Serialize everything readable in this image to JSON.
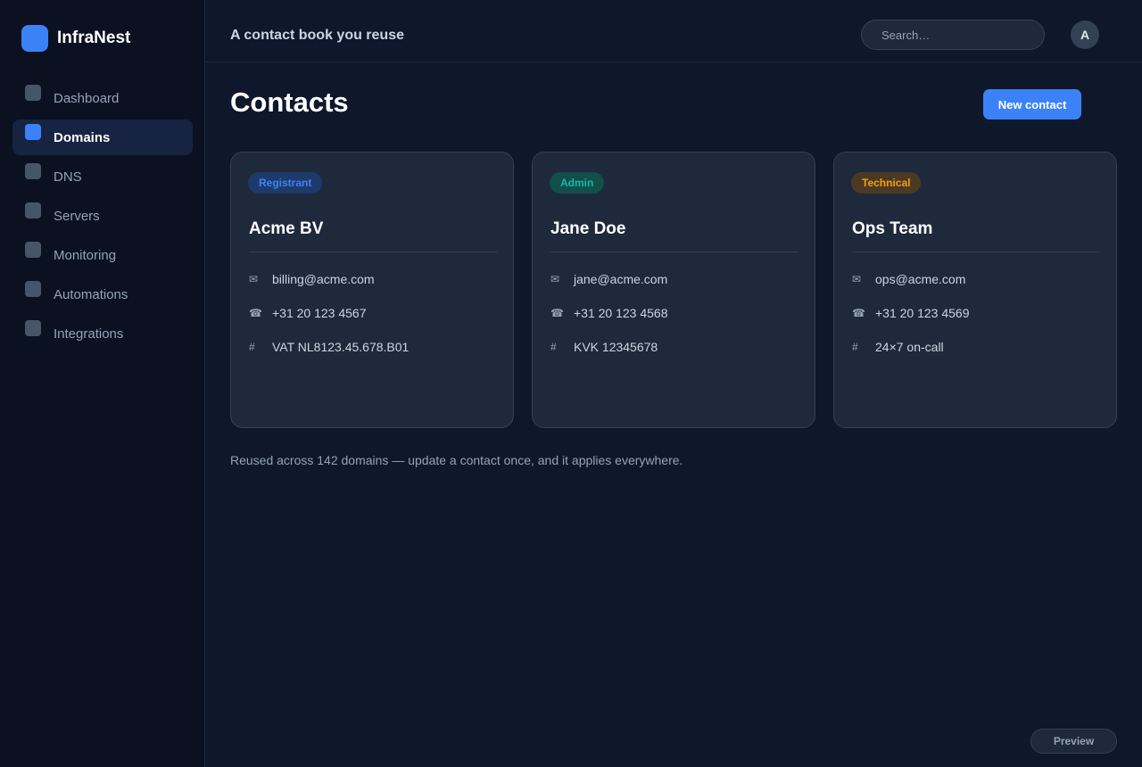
{
  "app": {
    "name": "InfraNest",
    "tagline": "A contact book you reuse"
  },
  "sidebar": {
    "items": [
      {
        "label": "Dashboard",
        "active": false
      },
      {
        "label": "Domains",
        "active": true
      },
      {
        "label": "DNS",
        "active": false
      },
      {
        "label": "Servers",
        "active": false
      },
      {
        "label": "Monitoring",
        "active": false
      },
      {
        "label": "Automations",
        "active": false
      },
      {
        "label": "Integrations",
        "active": false
      }
    ]
  },
  "header": {
    "search_placeholder": "Search…",
    "avatar_initial": "A"
  },
  "main": {
    "title": "Contacts",
    "new_button": "New contact",
    "cards": [
      {
        "role": "Registrant",
        "role_color": "#3b82f6",
        "name": "Acme BV",
        "email": "billing@acme.com",
        "phone": "+31 20 123 4567",
        "id": "VAT NL8123.45.678.B01"
      },
      {
        "role": "Admin",
        "role_color": "#14b8a6",
        "name": "Jane Doe",
        "email": "jane@acme.com",
        "phone": "+31 20 123 4568",
        "id": "KVK 12345678"
      },
      {
        "role": "Technical",
        "role_color": "#f59e0b",
        "name": "Ops Team",
        "email": "ops@acme.com",
        "phone": "+31 20 123 4569",
        "id": "24×7 on-call"
      }
    ],
    "icons": {
      "email": "✉",
      "phone": "☎",
      "id": "#"
    },
    "footnote": "Reused across 142 domains — update a contact once, and it applies everywhere.",
    "preview_button": "Preview"
  },
  "colors": {
    "accent": "#3b82f6",
    "background": "#0f172a",
    "card": "#1e293b"
  }
}
